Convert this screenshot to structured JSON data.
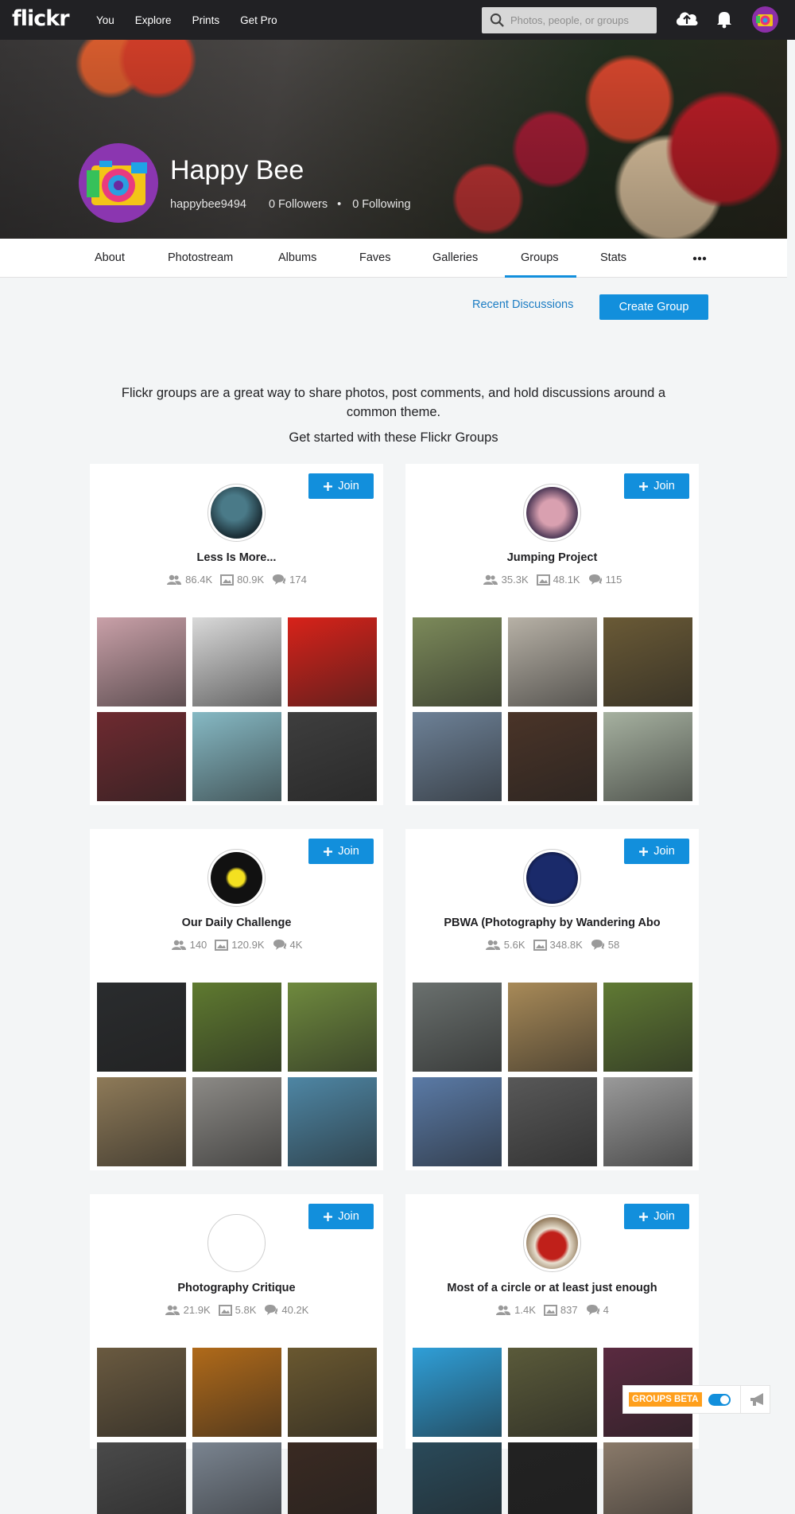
{
  "topbar": {
    "logo": "flickr",
    "nav": [
      "You",
      "Explore",
      "Prints",
      "Get Pro"
    ],
    "search_placeholder": "Photos, people, or groups"
  },
  "profile": {
    "name": "Happy Bee",
    "username": "happybee9494",
    "followers": "0 Followers",
    "following": "0 Following",
    "separator": "•"
  },
  "subnav": {
    "items": [
      "About",
      "Photostream",
      "Albums",
      "Faves",
      "Galleries",
      "Groups",
      "Stats"
    ],
    "active": "Groups"
  },
  "actions": {
    "recent_discussions": "Recent Discussions",
    "create_group": "Create Group"
  },
  "intro": {
    "text": "Flickr groups are a great way to share photos, post comments, and hold discussions around a common theme.",
    "subtext": "Get started with these Flickr Groups"
  },
  "join_label": "Join",
  "groups": [
    {
      "name": "Less Is More...",
      "members": "86.4K",
      "photos": "80.9K",
      "discussions": "174",
      "thumbs": [
        "#c9a0a8",
        "#d9d9d9",
        "#d8221a",
        "#6e2a30",
        "#86b9c4",
        "#3e3e3e"
      ]
    },
    {
      "name": "Jumping Project",
      "members": "35.3K",
      "photos": "48.1K",
      "discussions": "115",
      "thumbs": [
        "#7c8a5a",
        "#b7b1a6",
        "#6a5a36",
        "#6d8197",
        "#4a3428",
        "#a6b1a0"
      ]
    },
    {
      "name": "Our Daily Challenge",
      "members": "140",
      "photos": "120.9K",
      "discussions": "4K",
      "thumbs": [
        "#2a2c2e",
        "#5f7a30",
        "#6f8a3e",
        "#8e7a58",
        "#8c8a86",
        "#4e86a4"
      ]
    },
    {
      "name": "PBWA (Photography by Wandering Abo",
      "members": "5.6K",
      "photos": "348.8K",
      "discussions": "58",
      "thumbs": [
        "#6a706e",
        "#a88a58",
        "#607a34",
        "#5a7aa6",
        "#585858",
        "#9a9a9a"
      ]
    },
    {
      "name": "Photography Critique",
      "members": "21.9K",
      "photos": "5.8K",
      "discussions": "40.2K",
      "thumbs": [
        "#6a5a40",
        "#b06a1a",
        "#6a5830",
        "#4a4a4a",
        "#7a8490",
        "#3a2a22"
      ]
    },
    {
      "name": "Most of a circle or at least just enough",
      "members": "1.4K",
      "photos": "837",
      "discussions": "4",
      "thumbs": [
        "#2f9fd8",
        "#5a5a3a",
        "#5a2a40",
        "#2a4a5a",
        "#222222",
        "#8a7a6a"
      ]
    }
  ],
  "beta": {
    "label": "GROUPS BETA"
  },
  "colors": {
    "accent": "#128fdc",
    "topbar": "#212124",
    "beta": "#ff9f1c"
  }
}
